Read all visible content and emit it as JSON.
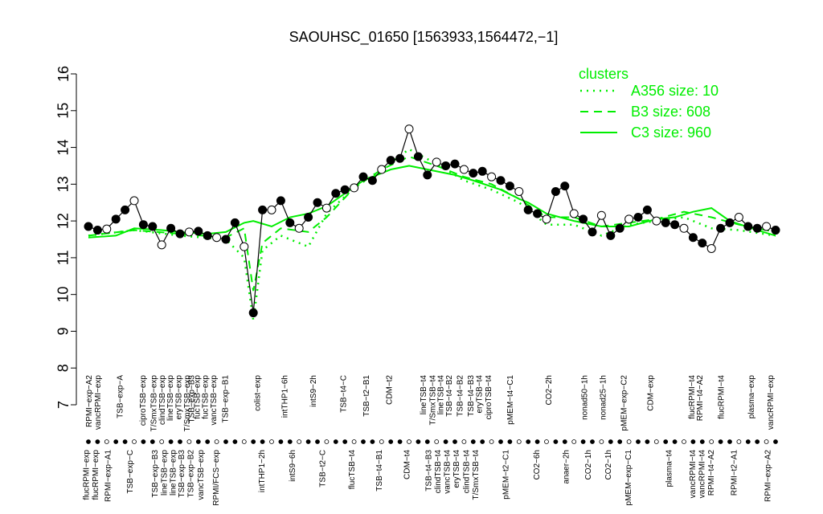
{
  "chart_data": {
    "type": "line",
    "title": "SAOUHSC_01650 [1563933,1564472,−1]",
    "xlabel": "",
    "ylabel": "",
    "ylim": [
      7,
      16
    ],
    "y_ticks": [
      7,
      8,
      9,
      10,
      11,
      12,
      13,
      14,
      15,
      16
    ],
    "grid": false,
    "legend": {
      "title": "clusters",
      "placement": "top-right",
      "color": "#00ee00",
      "entries": [
        {
          "label": "A356 size: 10",
          "style": "dotted"
        },
        {
          "label": "B3 size: 608",
          "style": "dashed"
        },
        {
          "label": "C3 size: 960",
          "style": "solid"
        }
      ]
    },
    "colors": {
      "cluster": "#00ee00",
      "data": "#000000"
    },
    "x_labels_top": [
      {
        "x": 0.1,
        "text": "RPMI−exp−A2"
      },
      {
        "x": 1.1,
        "text": "vancRPMI−exp"
      },
      {
        "x": 3.5,
        "text": "TSB−exp−A"
      },
      {
        "x": 6.0,
        "text": "ciproTSB−exp"
      },
      {
        "x": 7.2,
        "text": "T/SmxTSB−exp"
      },
      {
        "x": 8.1,
        "text": "clindTSB−exp"
      },
      {
        "x": 9.0,
        "text": "lineTSB−exp"
      },
      {
        "x": 9.9,
        "text": "eryTSB−exp"
      },
      {
        "x": 10.8,
        "text": "T/SmxTSB−exp"
      },
      {
        "x": 11.3,
        "text": "TSB−exp−B3"
      },
      {
        "x": 11.9,
        "text": "fucTSB−exp"
      },
      {
        "x": 12.8,
        "text": "fucTSB−exp"
      },
      {
        "x": 13.7,
        "text": "vancTSB−exp"
      },
      {
        "x": 15.0,
        "text": "TSB−exp−B1"
      },
      {
        "x": 18.5,
        "text": "colist−exp"
      },
      {
        "x": 21.5,
        "text": "intTHP1−6h"
      },
      {
        "x": 24.6,
        "text": "intS9−2h"
      },
      {
        "x": 27.9,
        "text": "TSB−t4−C"
      },
      {
        "x": 30.4,
        "text": "TSB−t2−B1"
      },
      {
        "x": 32.9,
        "text": "CDM−t2"
      },
      {
        "x": 36.6,
        "text": "lineTSB−t4"
      },
      {
        "x": 37.6,
        "text": "T/SmxTSB−t4"
      },
      {
        "x": 38.5,
        "text": "lineTSB−t4"
      },
      {
        "x": 39.4,
        "text": "TSB−t4−B2"
      },
      {
        "x": 40.6,
        "text": "TSB−t4−B2"
      },
      {
        "x": 41.8,
        "text": "TSB−t4−B3"
      },
      {
        "x": 42.7,
        "text": "eryTSB−t4"
      },
      {
        "x": 43.7,
        "text": "ciproTSB−t4"
      },
      {
        "x": 46.1,
        "text": "pMEM−t4−C1"
      },
      {
        "x": 50.3,
        "text": "CO2−2h"
      },
      {
        "x": 54.2,
        "text": "nonad50−1h"
      },
      {
        "x": 56.2,
        "text": "nonad25−1h"
      },
      {
        "x": 58.5,
        "text": "pMEM−exp−C2"
      },
      {
        "x": 61.4,
        "text": "CDM−exp"
      },
      {
        "x": 65.9,
        "text": "flucRPMI−t4"
      },
      {
        "x": 66.8,
        "text": "RPMI−t4−A2"
      },
      {
        "x": 69.1,
        "text": "flucRPMI−t4"
      },
      {
        "x": 72.4,
        "text": "plasma−exp"
      },
      {
        "x": 74.5,
        "text": "vancRPMI−exp"
      }
    ],
    "x_labels_bottom": [
      {
        "x": -0.2,
        "text": "flucRPMI−exp"
      },
      {
        "x": 0.8,
        "text": "flucRPMI−exp"
      },
      {
        "x": 2.2,
        "text": "RPMI−exp−A1"
      },
      {
        "x": 4.6,
        "text": "TSB−exp−C"
      },
      {
        "x": 7.3,
        "text": "TSB−exp−B3"
      },
      {
        "x": 8.3,
        "text": "lineTSB−exp"
      },
      {
        "x": 9.3,
        "text": "lineTSB−exp"
      },
      {
        "x": 10.2,
        "text": "TSB−exp−B3"
      },
      {
        "x": 11.2,
        "text": "TSB−exp−B2"
      },
      {
        "x": 12.3,
        "text": "vancTSB−exp"
      },
      {
        "x": 14.0,
        "text": "RPMI/FCS−exp"
      },
      {
        "x": 19.0,
        "text": "intTHP1−2h"
      },
      {
        "x": 22.3,
        "text": "intS9−6h"
      },
      {
        "x": 25.6,
        "text": "TSB−t2−C"
      },
      {
        "x": 28.8,
        "text": "flucTSB−t4"
      },
      {
        "x": 31.8,
        "text": "TSB−t4−B1"
      },
      {
        "x": 34.8,
        "text": "CDM−t4"
      },
      {
        "x": 37.2,
        "text": "TSB−t4−B3"
      },
      {
        "x": 38.2,
        "text": "clindTSB−t4"
      },
      {
        "x": 39.2,
        "text": "vancTSB−t4"
      },
      {
        "x": 40.2,
        "text": "eryTSB−t4"
      },
      {
        "x": 41.3,
        "text": "clindTSB−t4"
      },
      {
        "x": 42.3,
        "text": "T/SmxTSB−t4"
      },
      {
        "x": 45.6,
        "text": "pMEM−t2−C1"
      },
      {
        "x": 49.0,
        "text": "CO2−6h"
      },
      {
        "x": 52.2,
        "text": "anaer−2h"
      },
      {
        "x": 54.6,
        "text": "CO2−1h"
      },
      {
        "x": 56.8,
        "text": "CO2−1h"
      },
      {
        "x": 59.0,
        "text": "pMEM−exp−C1"
      },
      {
        "x": 63.4,
        "text": "plasma−t4"
      },
      {
        "x": 66.0,
        "text": "vancRPMI−t4"
      },
      {
        "x": 67.0,
        "text": "vancRPMI−t4"
      },
      {
        "x": 68.0,
        "text": "RPMI−t4−A2"
      },
      {
        "x": 70.5,
        "text": "RPMI−t2−A1"
      },
      {
        "x": 74.2,
        "text": "RPMI−exp−A2"
      }
    ],
    "series": [
      {
        "label": "expression",
        "x": [
          0,
          1,
          2,
          3,
          4,
          5,
          6,
          7,
          8,
          9,
          10,
          11,
          12,
          13,
          14,
          15,
          16,
          17,
          18,
          19,
          20,
          21,
          22,
          23,
          24,
          25,
          26,
          27,
          28,
          29,
          30,
          31,
          32,
          33,
          34,
          35,
          36,
          37,
          38,
          39,
          40,
          41,
          42,
          43,
          44,
          45,
          46,
          47,
          48,
          49,
          50,
          51,
          52,
          53,
          54,
          55,
          56,
          57,
          58,
          59,
          60,
          61,
          62,
          63,
          64,
          65,
          66,
          67,
          68,
          69,
          70,
          71,
          72,
          73,
          74,
          75
        ],
        "values": [
          11.85,
          11.75,
          11.78,
          12.05,
          12.3,
          12.55,
          11.9,
          11.85,
          11.35,
          11.8,
          11.65,
          11.7,
          11.72,
          11.6,
          11.55,
          11.5,
          11.95,
          11.3,
          9.5,
          12.3,
          12.3,
          12.55,
          11.95,
          11.8,
          12.1,
          12.5,
          12.35,
          12.75,
          12.85,
          12.9,
          13.2,
          13.1,
          13.4,
          13.65,
          13.7,
          14.5,
          13.75,
          13.25,
          13.6,
          13.5,
          13.55,
          13.4,
          13.3,
          13.35,
          13.2,
          13.1,
          12.95,
          12.8,
          12.3,
          12.2,
          12.05,
          12.8,
          12.95,
          12.2,
          12.05,
          11.7,
          12.15,
          11.6,
          11.8,
          12.05,
          12.1,
          12.3,
          12.0,
          11.95,
          11.9,
          11.8,
          11.55,
          11.4,
          11.25,
          11.8,
          11.95,
          12.1,
          11.85,
          11.8,
          11.85,
          11.75
        ]
      },
      {
        "label": "A356 size: 10",
        "x": [
          0,
          5,
          10,
          15,
          17,
          18,
          19,
          21,
          24,
          26,
          29,
          32,
          35,
          38,
          41,
          44,
          47,
          50,
          53,
          56,
          59,
          62,
          65,
          68,
          71,
          75
        ],
        "values": [
          11.6,
          11.75,
          11.6,
          11.5,
          11.0,
          9.3,
          11.2,
          11.6,
          11.3,
          12.2,
          12.9,
          13.4,
          13.95,
          13.55,
          13.1,
          12.85,
          12.5,
          11.9,
          11.9,
          11.6,
          11.9,
          12.0,
          12.1,
          11.8,
          11.75,
          11.6
        ]
      },
      {
        "label": "B3 size: 608",
        "x": [
          0,
          5,
          10,
          15,
          17,
          18,
          19,
          21,
          24,
          26,
          29,
          32,
          35,
          38,
          41,
          44,
          47,
          50,
          53,
          56,
          59,
          62,
          65,
          68,
          71,
          75
        ],
        "values": [
          11.6,
          11.75,
          11.65,
          11.55,
          11.8,
          10.1,
          11.4,
          11.8,
          11.7,
          12.1,
          12.9,
          13.4,
          13.75,
          13.5,
          13.2,
          13.0,
          12.6,
          12.1,
          12.1,
          11.85,
          11.95,
          12.05,
          12.25,
          12.1,
          11.9,
          11.7
        ]
      },
      {
        "label": "C3 size: 960",
        "x": [
          0,
          3,
          5,
          8,
          10,
          13,
          15,
          17,
          18,
          20,
          22,
          24,
          26,
          28,
          30,
          33,
          35,
          37,
          40,
          42,
          45,
          47,
          48,
          50,
          53,
          56,
          59,
          62,
          64,
          66,
          68,
          70,
          73,
          75
        ],
        "values": [
          11.55,
          11.6,
          11.8,
          11.75,
          11.7,
          11.65,
          11.7,
          11.95,
          12.0,
          11.85,
          12.1,
          12.2,
          12.4,
          12.75,
          13.1,
          13.4,
          13.5,
          13.4,
          13.25,
          13.1,
          12.85,
          12.6,
          12.5,
          12.2,
          12.0,
          11.85,
          11.85,
          12.05,
          12.1,
          12.25,
          12.35,
          12.0,
          11.75,
          11.6
        ]
      }
    ]
  }
}
